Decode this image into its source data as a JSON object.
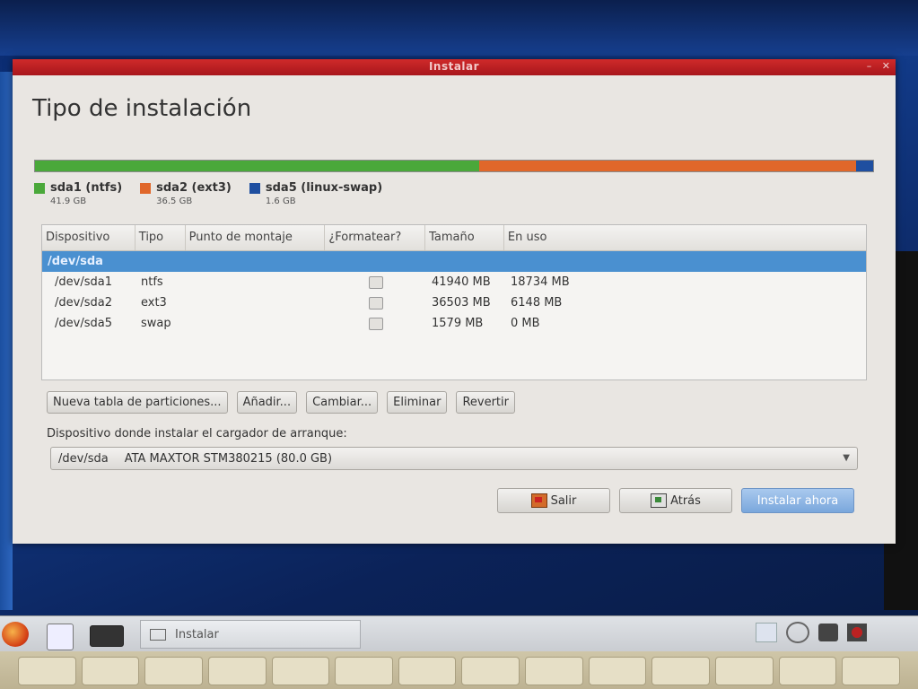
{
  "window": {
    "title": "Instalar"
  },
  "page": {
    "heading": "Tipo de instalación"
  },
  "partition_bar": {
    "segments": [
      {
        "name": "sda1 (ntfs)",
        "size": "41.9 GB",
        "color": "#4aa83a",
        "fraction": 0.53
      },
      {
        "name": "sda2 (ext3)",
        "size": "36.5 GB",
        "color": "#e0672a",
        "fraction": 0.45
      },
      {
        "name": "sda5 (linux-swap)",
        "size": "1.6 GB",
        "color": "#1f4fa0",
        "fraction": 0.02
      }
    ]
  },
  "table": {
    "headers": [
      "Dispositivo",
      "Tipo",
      "Punto de montaje",
      "¿Formatear?",
      "Tamaño",
      "En uso"
    ],
    "device_row": "/dev/sda",
    "rows": [
      {
        "device": "/dev/sda1",
        "type": "ntfs",
        "mount": "",
        "format": false,
        "size": "41940 MB",
        "used": "18734 MB"
      },
      {
        "device": "/dev/sda2",
        "type": "ext3",
        "mount": "",
        "format": false,
        "size": "36503 MB",
        "used": "6148 MB"
      },
      {
        "device": "/dev/sda5",
        "type": "swap",
        "mount": "",
        "format": false,
        "size": "1579 MB",
        "used": "0 MB"
      }
    ]
  },
  "partition_buttons": {
    "new_table": "Nueva tabla de particiones...",
    "add": "Añadir...",
    "change": "Cambiar...",
    "delete": "Eliminar",
    "revert": "Revertir"
  },
  "bootloader": {
    "label": "Dispositivo donde instalar el cargador de arranque:",
    "device": "/dev/sda",
    "description": "ATA MAXTOR STM380215 (80.0 GB)"
  },
  "actions": {
    "quit": "Salir",
    "back": "Atrás",
    "install": "Instalar ahora"
  },
  "taskbar": {
    "task_label": "Instalar"
  }
}
